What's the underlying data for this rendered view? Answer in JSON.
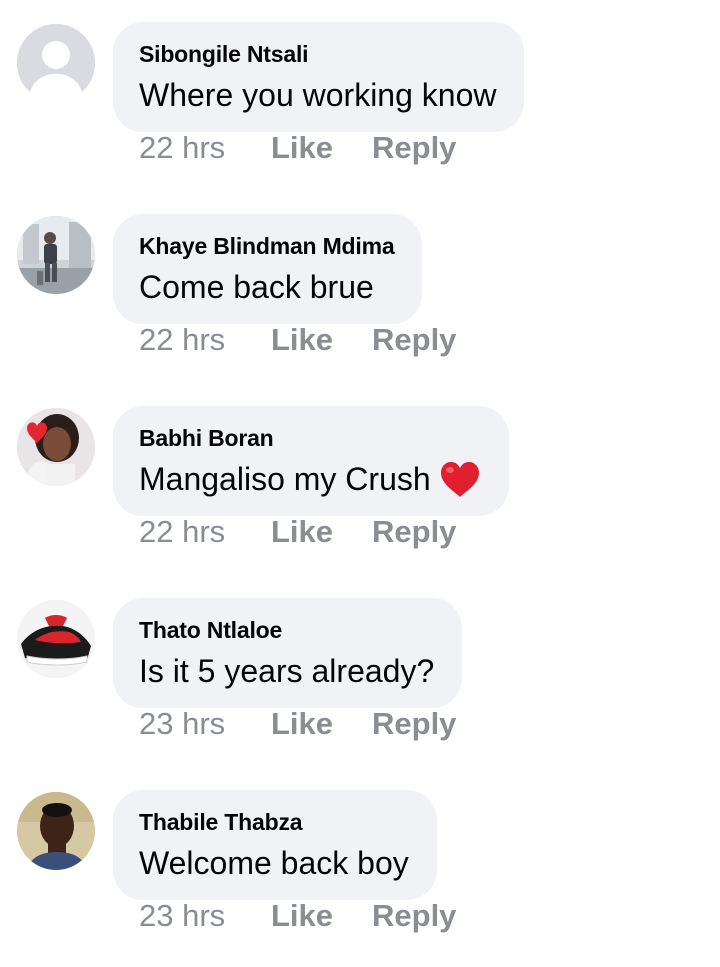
{
  "comments": [
    {
      "author": "Sibongile Ntsali",
      "text": "Where you working know",
      "time": "22 hrs",
      "like_label": "Like",
      "reply_label": "Reply",
      "avatar": "default-avatar-silhouette"
    },
    {
      "author": "Khaye Blindman Mdima",
      "text": "Come back brue",
      "time": "22 hrs",
      "like_label": "Like",
      "reply_label": "Reply",
      "avatar": "person-standing-photo"
    },
    {
      "author": "Babhi Boran",
      "text": "Mangaliso my Crush",
      "time": "22 hrs",
      "like_label": "Like",
      "reply_label": "Reply",
      "avatar": "woman-portrait-photo",
      "emoji": "red-heart"
    },
    {
      "author": "Thato Ntlaloe",
      "text": "Is it 5 years already?",
      "time": "23 hrs",
      "like_label": "Like",
      "reply_label": "Reply",
      "avatar": "red-sneaker-photo"
    },
    {
      "author": "Thabile Thabza",
      "text": "Welcome back boy",
      "time": "23 hrs",
      "like_label": "Like",
      "reply_label": "Reply",
      "avatar": "man-portrait-photo"
    }
  ],
  "colors": {
    "bubble": "#f0f2f5",
    "meta_text": "#8a8d91",
    "author_text": "#050505",
    "heart": "#e0202e"
  }
}
